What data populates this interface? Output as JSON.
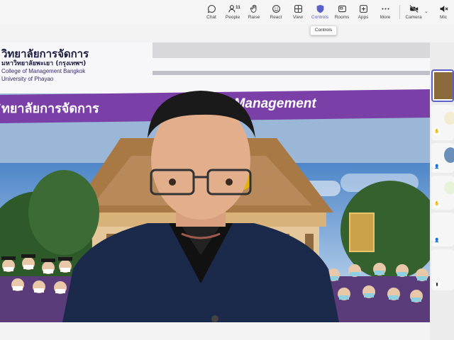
{
  "toolbar": {
    "items": [
      {
        "label": "Chat",
        "icon": "chat-icon"
      },
      {
        "label": "People",
        "icon": "people-icon",
        "count": "11"
      },
      {
        "label": "Raise",
        "icon": "hand-icon"
      },
      {
        "label": "React",
        "icon": "smiley-icon"
      },
      {
        "label": "View",
        "icon": "grid-icon"
      },
      {
        "label": "Controls",
        "icon": "shield-icon"
      },
      {
        "label": "Rooms",
        "icon": "rooms-icon"
      },
      {
        "label": "Apps",
        "icon": "apps-icon"
      },
      {
        "label": "More",
        "icon": "more-icon"
      },
      {
        "label": "Camera",
        "icon": "camera-off-icon"
      },
      {
        "label": "Mic",
        "icon": "mic-icon"
      }
    ],
    "tooltip": "Controls"
  },
  "stage": {
    "thai_title": "วิทยาลัยการจัดการ",
    "thai_subtitle": "มหาวิทยาลัยพะเยา (กรุงเทพฯ)",
    "english_line1": "College of Management Bangkok",
    "english_line2": "University of Phayao",
    "banner_thai": "ิทยาลัยการจัดการ",
    "banner_english": "f Management"
  },
  "colors": {
    "accent": "#5b5fc7",
    "banner_purple": "#7b3fa8"
  }
}
